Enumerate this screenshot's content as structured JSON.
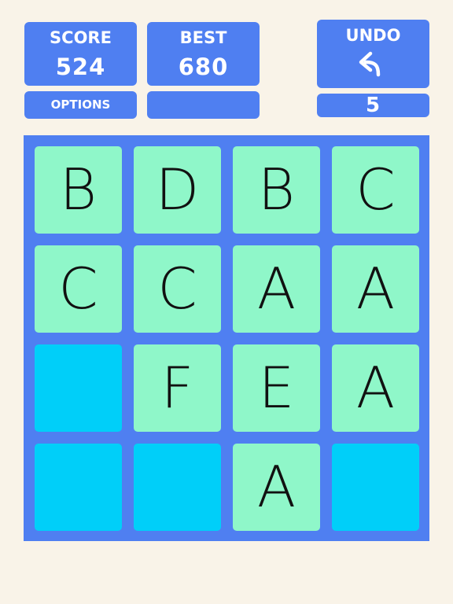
{
  "stats": {
    "score_label": "SCORE",
    "score_value": "524",
    "best_label": "BEST",
    "best_value": "680",
    "undo_label": "UNDO",
    "undo_icon": "undo-arrow-icon",
    "undo_count": "5",
    "options_label": "OPTIONS",
    "blank_label": ""
  },
  "board": {
    "rows": [
      [
        "B",
        "D",
        "B",
        "C"
      ],
      [
        "C",
        "C",
        "A",
        "A"
      ],
      [
        "",
        "F",
        "E",
        "A"
      ],
      [
        "",
        "",
        "A",
        ""
      ]
    ]
  },
  "colors": {
    "background": "#f9f3e8",
    "panel": "#4f7ff1",
    "tile_filled": "#8ff7c9",
    "tile_empty": "#00cff9"
  }
}
